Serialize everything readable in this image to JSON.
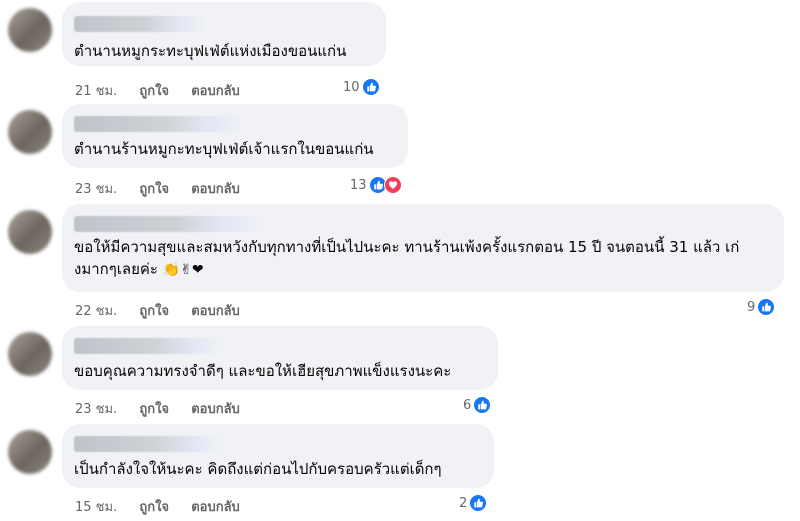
{
  "actions": {
    "like": "ถูกใจ",
    "reply": "ตอบกลับ"
  },
  "colors": {
    "like_blue": "#1877f2",
    "love_red": "#f33e58",
    "bubble": "#f0f2f5",
    "meta": "#65676b"
  },
  "comments": [
    {
      "text": "ตำนานหมูกระทะบุฟเฟ่ต์แห่งเมืองขอนแก่น",
      "time": "21 ชม.",
      "reactions": "10",
      "reaction_icons": [
        "like-icon"
      ]
    },
    {
      "text": "ตำนานร้านหมูกะทะบุฟเฟ่ต์เจ้าแรกในขอนแก่น",
      "time": "23 ชม.",
      "reactions": "13",
      "reaction_icons": [
        "like-icon",
        "love-icon"
      ]
    },
    {
      "text": "ขอให้มีความสุขและสมหวังกับทุกทางที่เป็นไปนะคะ ทานร้านเพ้งครั้งแรกตอน 15 ปี จนตอนนี้ 31 แล้ว เก่งมากๆเลยค่ะ",
      "emojis": "👏✌❤",
      "time": "22 ชม.",
      "reactions": "9",
      "reaction_icons": [
        "like-icon"
      ]
    },
    {
      "text": "ขอบคุณความทรงจำดีๆ และขอให้เฮียสุขภาพแข็งแรงนะคะ",
      "time": "23 ชม.",
      "reactions": "6",
      "reaction_icons": [
        "like-icon"
      ]
    },
    {
      "text": "เป็นกำลังใจให้นะคะ คิดถึงแต่ก่อนไปกับครอบครัวแต่เด็กๆ",
      "time": "15 ชม.",
      "reactions": "2",
      "reaction_icons": [
        "like-icon"
      ]
    }
  ]
}
